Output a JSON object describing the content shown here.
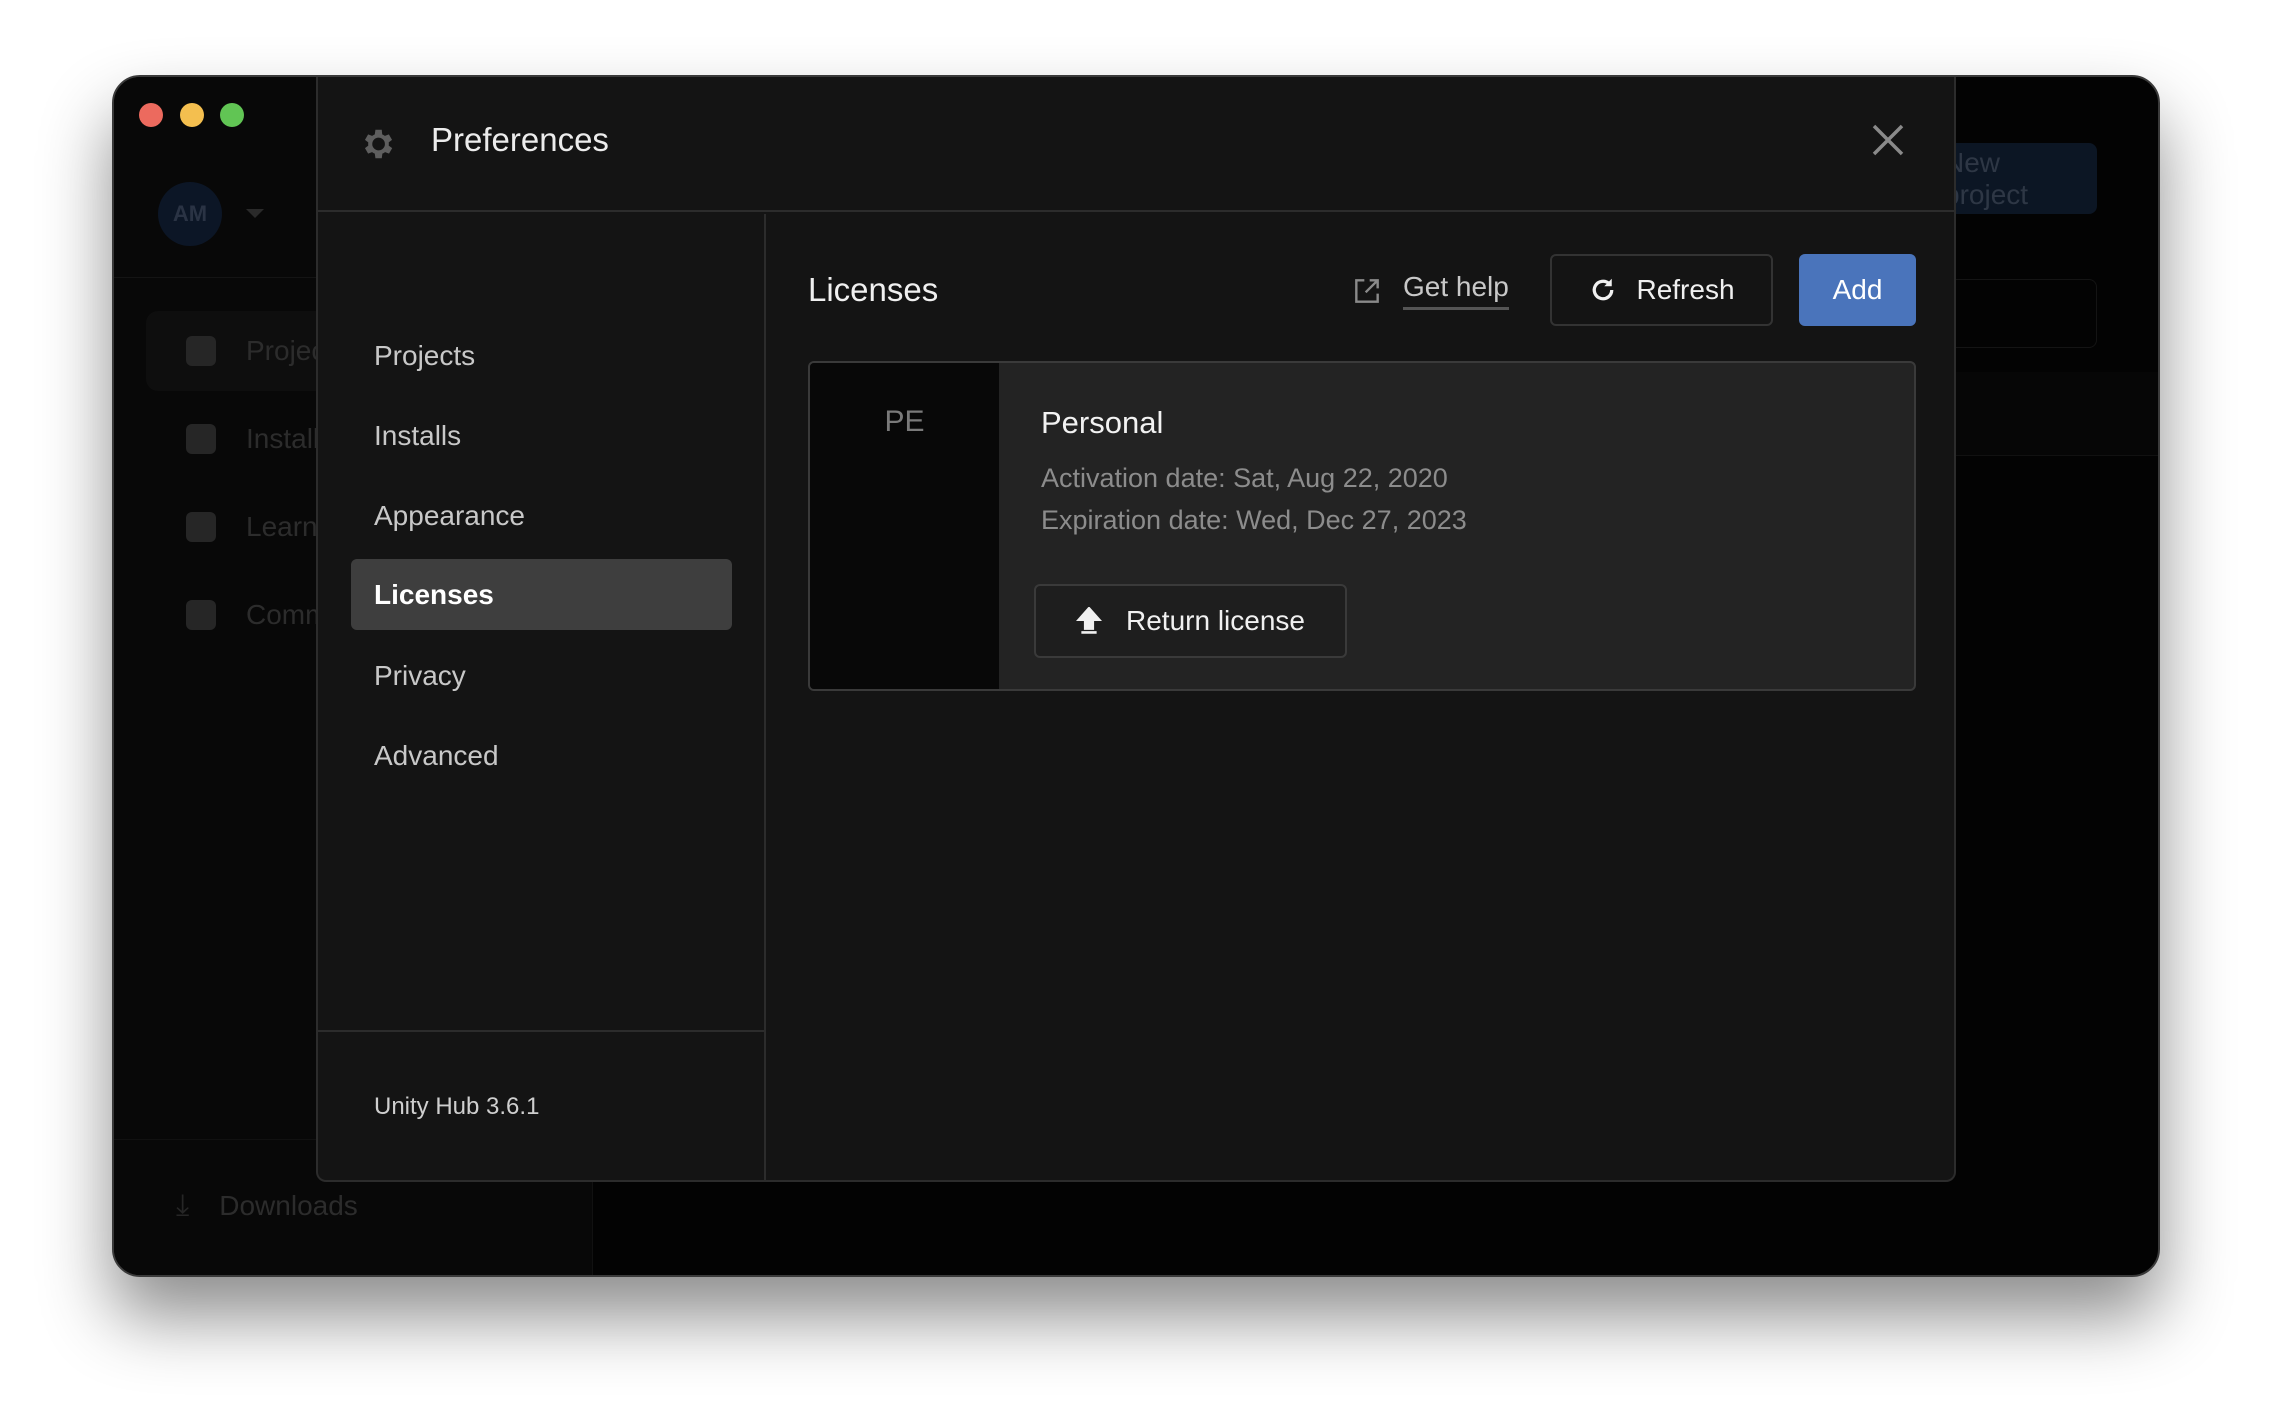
{
  "window": {
    "traffic_lights": {
      "close": "#ec6a5e",
      "minimize": "#f4bf4f",
      "maximize": "#61c554"
    }
  },
  "background": {
    "avatar_initials": "AM",
    "sidebar": [
      {
        "label": "Projects",
        "icon": "cube-icon"
      },
      {
        "label": "Installs",
        "icon": "drive-icon"
      },
      {
        "label": "Learn",
        "icon": "graduation-cap-icon"
      },
      {
        "label": "Community",
        "icon": "people-icon"
      }
    ],
    "downloads_label": "Downloads",
    "new_project_label": "New project"
  },
  "dialog": {
    "title": "Preferences",
    "nav": [
      {
        "label": "Projects"
      },
      {
        "label": "Installs"
      },
      {
        "label": "Appearance"
      },
      {
        "label": "Licenses",
        "selected": true
      },
      {
        "label": "Privacy"
      },
      {
        "label": "Advanced"
      }
    ],
    "version": "Unity Hub 3.6.1",
    "content": {
      "heading": "Licenses",
      "get_help": "Get help",
      "refresh": "Refresh",
      "add": "Add",
      "accent": "#4a74bb",
      "license": {
        "badge": "PE",
        "name": "Personal",
        "activation": "Activation date: Sat, Aug 22, 2020",
        "expiration": "Expiration date: Wed, Dec 27, 2023",
        "return_label": "Return license"
      }
    }
  }
}
